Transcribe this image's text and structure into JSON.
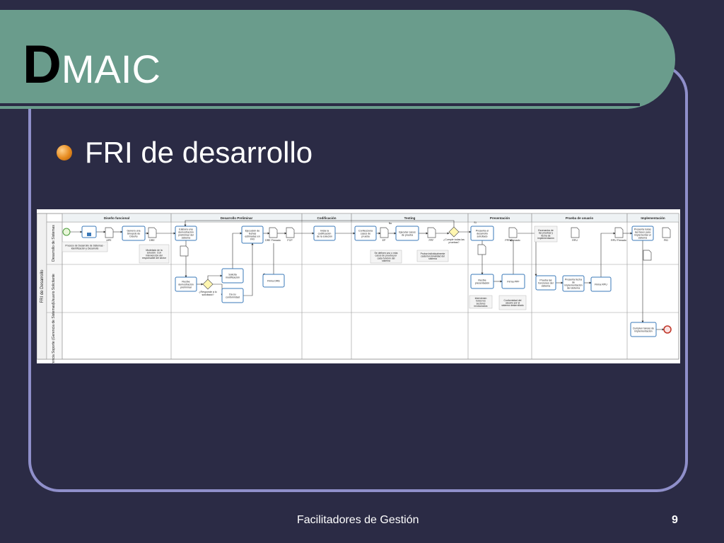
{
  "slide": {
    "title_first_letter": "D",
    "title_rest": "MAIC",
    "bullet": "FRI de desarrollo",
    "footer": "Facilitadores de Gestión",
    "page_number": "9"
  },
  "colors": {
    "background": "#2b2b45",
    "title_band": "#6a9c8c",
    "frame_border": "#8f8fca",
    "bullet": "#e68a1e"
  },
  "diagram": {
    "pool_label": "FRI de Desarrollo",
    "lanes": [
      "Desarrollo de Sistemas",
      "Usuario Solicitante",
      "Gerencia Soporte (Gerencia de Sistemas)"
    ],
    "phases": [
      "Diseño funcional",
      "Desarrollo Preliminar",
      "Codificación",
      "Testing",
      "Presentación",
      "Prueba de usuario",
      "Implementación"
    ],
    "tasks": [
      {
        "label": "Genera una Sinopsis de Diseño"
      },
      {
        "label": "Elabora una demostración preliminar del sistema"
      },
      {
        "label": "Recibe demostración preliminar"
      },
      {
        "label": "Solicita modificación"
      },
      {
        "label": "Da su conformidad"
      },
      {
        "label": "Ejecución de fechas estimadas en FRI"
      },
      {
        "label": "Firma DRE"
      },
      {
        "label": "Inicia la codificación de la solución"
      },
      {
        "label": "Confecciona casos de prueba"
      },
      {
        "label": "Ejecutar casos de prueba"
      },
      {
        "label": "Presenta el desarrollo solicitado"
      },
      {
        "label": "Recibe presentación"
      },
      {
        "label": "Firma PPF"
      },
      {
        "label": "Prueba las funciones del sistema"
      },
      {
        "label": "Presenta fecha de implementación del sistema"
      },
      {
        "label": "Firma RPU"
      },
      {
        "label": "Presenta todas las fases para implementar el sistema"
      },
      {
        "label": "Cumplen tareas de implementación"
      }
    ],
    "documents": [
      "APE",
      "DRE",
      "DRE Firmado",
      "FCP",
      "EP",
      "PPF",
      "PPF Firmado",
      "RPU",
      "RPU Firmado",
      "PID"
    ],
    "notes": [
      "Proceso de Desarrollo de Sistemas - Identificación y Desarrollo",
      "Modelado de la solución. Con intervención del responsable del sector",
      "Se definen uno o más casos de prueba por cada función del sistema",
      "Probar individualmente cada funcionalidad del sistema",
      "Intervienen todos los sectores involucrados",
      "Conformidad del usuario por el sistema desarrollado",
      "Escenarios de las pruebas y fecha de implementación"
    ],
    "gateways": [
      "¿Responde a lo solicitado?",
      "¿Cumple todas las pruebas?"
    ],
    "flow_labels": [
      "No",
      "Sí"
    ]
  }
}
